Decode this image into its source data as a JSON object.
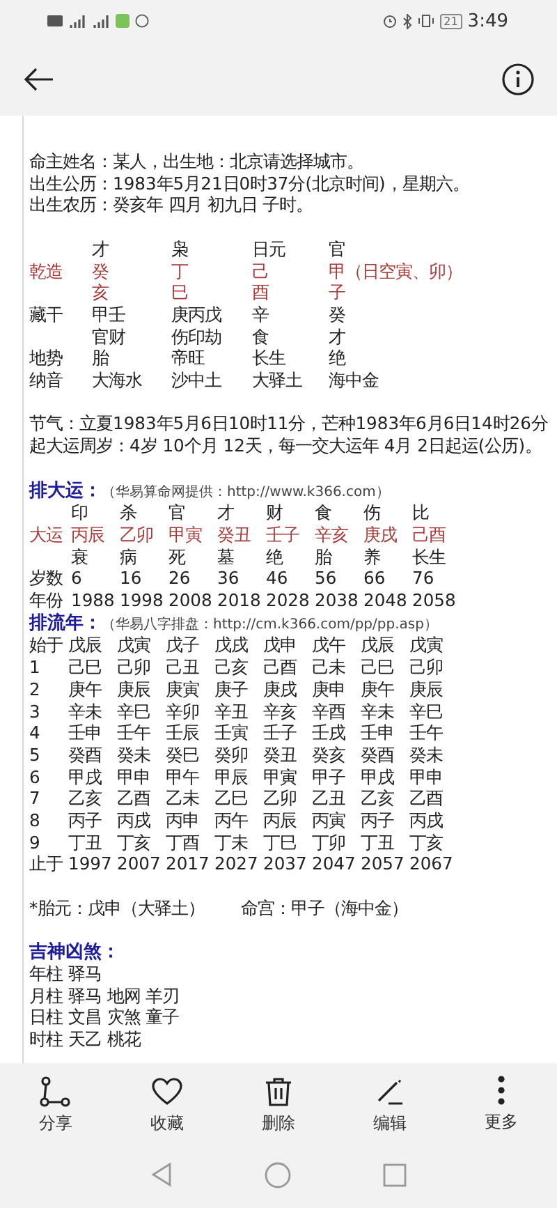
{
  "status_bar": {
    "battery": "21",
    "time": "3:49"
  },
  "document": {
    "intro_lines": [
      "命主姓名：某人，出生地：北京请选择城市。",
      "出生公历：1983年5月21日0时37分(北京时间)，星期六。",
      "出生农历：癸亥年 四月 初九日 子时。"
    ],
    "pillars": [
      {
        "kind": "plain",
        "cells": [
          "才",
          "枭",
          "日元",
          "官"
        ]
      },
      {
        "kind": "highlight",
        "label": "乾造",
        "cells": [
          "癸",
          "丁",
          "己",
          "甲（日空寅、卯）"
        ]
      },
      {
        "kind": "highlight",
        "cells": [
          "亥",
          "巳",
          "酉",
          "子"
        ]
      },
      {
        "kind": "plain",
        "label": "藏干",
        "cells": [
          "甲壬",
          "庚丙戊",
          "辛",
          "癸"
        ]
      },
      {
        "kind": "plain",
        "cells": [
          "官财",
          "伤印劫",
          "食",
          "才"
        ]
      },
      {
        "kind": "plain",
        "label": "地势",
        "cells": [
          "胎",
          "帝旺",
          "长生",
          "绝"
        ]
      },
      {
        "kind": "plain",
        "label": "纳音",
        "cells": [
          "大海水",
          "沙中土",
          "大驿土",
          "海中金"
        ]
      }
    ],
    "solar_lines": [
      "节气：立夏1983年5月6日10时11分，芒种1983年6月6日14时26分",
      "起大运周岁：4岁 10个月 12天，每一交大运年 4月 2日起运(公历)。"
    ],
    "dayun": {
      "heading": "排大运：",
      "source": "（华易算命网提供：http://www.k366.com）",
      "rows": [
        {
          "kind": "plain",
          "cells": [
            "印",
            "杀",
            "官",
            "才",
            "财",
            "食",
            "伤",
            "比"
          ]
        },
        {
          "kind": "highlight",
          "label": "大运",
          "cells": [
            "丙辰",
            "乙卯",
            "甲寅",
            "癸丑",
            "壬子",
            "辛亥",
            "庚戌",
            "己酉"
          ]
        },
        {
          "kind": "plain",
          "cells": [
            "衰",
            "病",
            "死",
            "墓",
            "绝",
            "胎",
            "养",
            "长生"
          ]
        },
        {
          "kind": "plain",
          "label": "岁数",
          "cells": [
            "6",
            "16",
            "26",
            "36",
            "46",
            "56",
            "66",
            "76"
          ]
        },
        {
          "kind": "plain",
          "label": "年份",
          "cells": [
            "1988",
            "1998",
            "2008",
            "2018",
            "2028",
            "2038",
            "2048",
            "2058"
          ]
        }
      ]
    },
    "liunian": {
      "heading": "排流年：",
      "source": "（华易八字排盘：http://cm.k366.com/pp/pp.asp）",
      "rows": [
        {
          "label": "始于",
          "cells": [
            "戊辰",
            "戊寅",
            "戊子",
            "戊戌",
            "戊申",
            "戊午",
            "戊辰",
            "戊寅"
          ]
        },
        {
          "label": "1",
          "cells": [
            "己巳",
            "己卯",
            "己丑",
            "己亥",
            "己酉",
            "己未",
            "己巳",
            "己卯"
          ]
        },
        {
          "label": "2",
          "cells": [
            "庚午",
            "庚辰",
            "庚寅",
            "庚子",
            "庚戌",
            "庚申",
            "庚午",
            "庚辰"
          ]
        },
        {
          "label": "3",
          "cells": [
            "辛未",
            "辛巳",
            "辛卯",
            "辛丑",
            "辛亥",
            "辛酉",
            "辛未",
            "辛巳"
          ]
        },
        {
          "label": "4",
          "cells": [
            "壬申",
            "壬午",
            "壬辰",
            "壬寅",
            "壬子",
            "壬戌",
            "壬申",
            "壬午"
          ]
        },
        {
          "label": "5",
          "cells": [
            "癸酉",
            "癸未",
            "癸巳",
            "癸卯",
            "癸丑",
            "癸亥",
            "癸酉",
            "癸未"
          ]
        },
        {
          "label": "6",
          "cells": [
            "甲戌",
            "甲申",
            "甲午",
            "甲辰",
            "甲寅",
            "甲子",
            "甲戌",
            "甲申"
          ]
        },
        {
          "label": "7",
          "cells": [
            "乙亥",
            "乙酉",
            "乙未",
            "乙巳",
            "乙卯",
            "乙丑",
            "乙亥",
            "乙酉"
          ]
        },
        {
          "label": "8",
          "cells": [
            "丙子",
            "丙戌",
            "丙申",
            "丙午",
            "丙辰",
            "丙寅",
            "丙子",
            "丙戌"
          ]
        },
        {
          "label": "9",
          "cells": [
            "丁丑",
            "丁亥",
            "丁酉",
            "丁未",
            "丁巳",
            "丁卯",
            "丁丑",
            "丁亥"
          ]
        },
        {
          "label": "止于",
          "cells": [
            "1997",
            "2007",
            "2017",
            "2027",
            "2037",
            "2047",
            "2057",
            "2067"
          ]
        }
      ]
    },
    "taiyuan": "*胎元：戊申（大驿土）",
    "minggong": "命宫：甲子（海中金）",
    "shensha": {
      "heading": "吉神凶煞：",
      "lines": [
        "年柱 驿马",
        "月柱 驿马 地网 羊刃",
        "日柱 文昌 灾煞 童子",
        "时柱 天乙 桃花"
      ]
    }
  },
  "toolbar": [
    {
      "kind": "share",
      "label": "分享"
    },
    {
      "kind": "heart",
      "label": "收藏"
    },
    {
      "kind": "trash",
      "label": "删除"
    },
    {
      "kind": "pen",
      "label": "编辑"
    },
    {
      "kind": "more",
      "label": "更多"
    }
  ]
}
